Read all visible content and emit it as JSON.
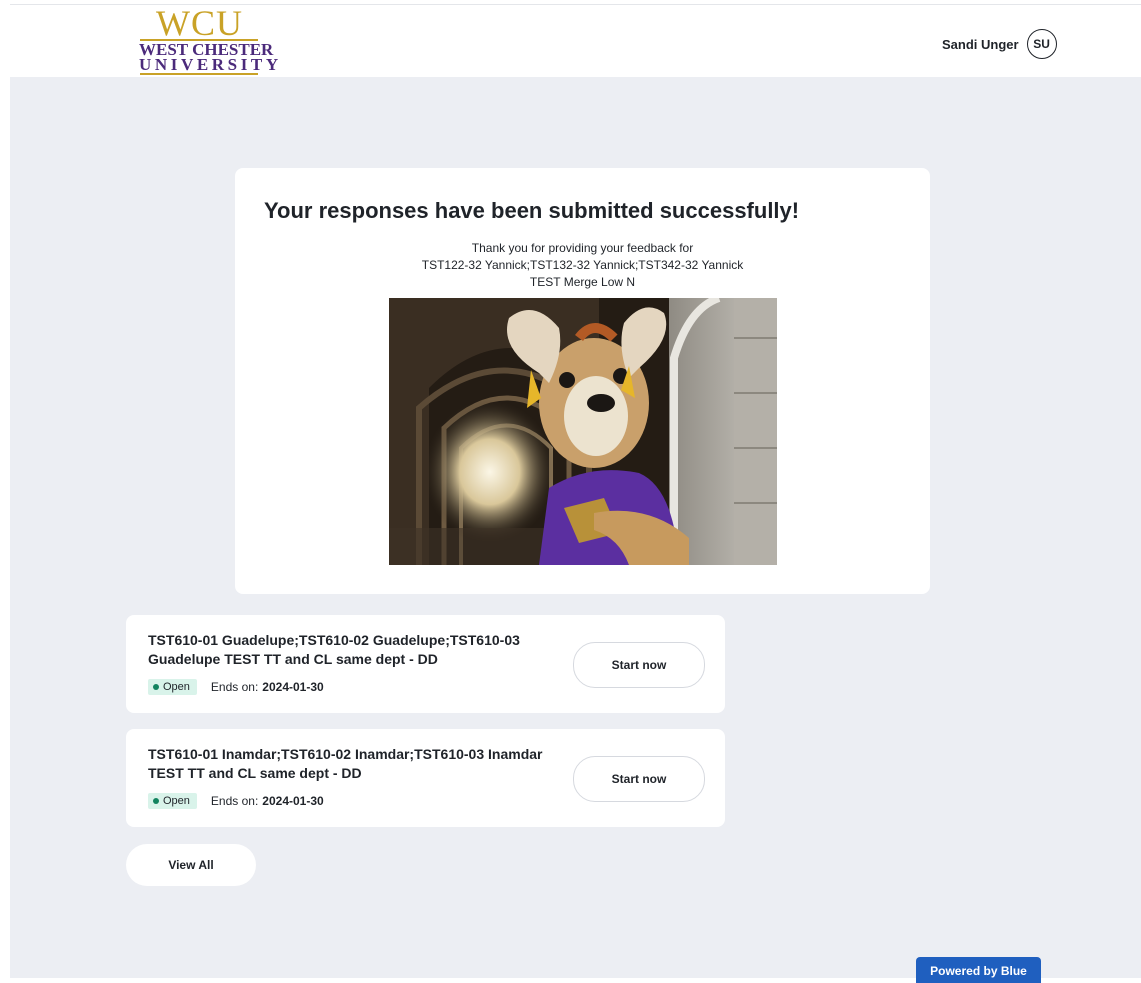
{
  "header": {
    "logo": {
      "mark": "WCU",
      "line1": "WEST CHESTER",
      "line2": "UNIVERSITY"
    },
    "user_name": "Sandi Unger",
    "user_initials": "SU"
  },
  "success": {
    "title": "Your responses have been submitted successfully!",
    "thanks_line1": "Thank you for providing your feedback for",
    "thanks_line2": "TST122-32 Yannick;TST132-32 Yannick;TST342-32 Yannick",
    "thanks_line3": "TEST Merge Low N"
  },
  "surveys": [
    {
      "title": "TST610-01 Guadelupe;TST610-02 Guadelupe;TST610-03 Guadelupe TEST TT and CL same dept - DD",
      "status": "Open",
      "ends_label": "Ends on:",
      "ends_date": "2024-01-30",
      "button_label": "Start now"
    },
    {
      "title": "TST610-01 Inamdar;TST610-02 Inamdar;TST610-03 Inamdar TEST TT and CL same dept - DD",
      "status": "Open",
      "ends_label": "Ends on:",
      "ends_date": "2024-01-30",
      "button_label": "Start now"
    }
  ],
  "view_all_label": "View All",
  "powered_by": "Powered by Blue",
  "colors": {
    "page_bg": "#eceef3",
    "accent_blue": "#1f5fbf",
    "status_open_bg": "#d9f3ea",
    "status_open_dot": "#12835f",
    "logo_gold": "#c9a227",
    "logo_purple": "#4b2a7b",
    "mascot_shirt": "#5b2fa0"
  }
}
